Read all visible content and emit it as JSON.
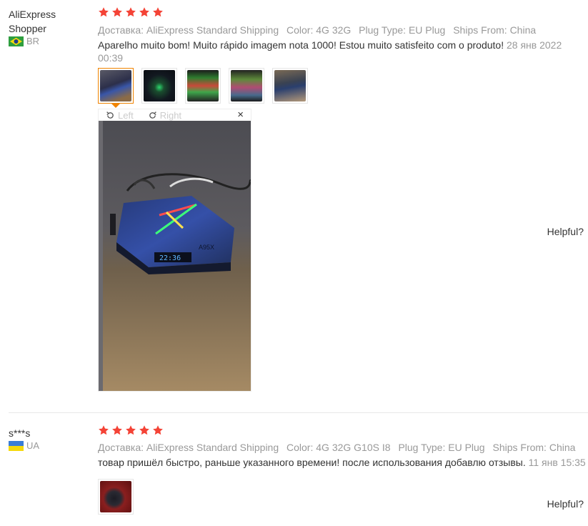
{
  "reviews": [
    {
      "user": {
        "name_line1": "AliExpress",
        "name_line2": "Shopper",
        "country": "BR",
        "flag": "brazil-flag"
      },
      "rating": 5,
      "meta": {
        "shipping": "Доставка: AliExpress Standard Shipping",
        "color": "Color: 4G 32G",
        "plug": "Plug Type: EU Plug",
        "ships_from": "Ships From: China"
      },
      "text": "Aparelho muito bom! Muito rápido imagem nota 1000! Estou muito satisfeito com o produto!",
      "date": "28 янв 2022 00:39",
      "thumbnails": [
        "photo-tv-box-blue",
        "photo-tv-box-dark",
        "photo-screen-green",
        "photo-screen-tv",
        "photo-box-hand"
      ],
      "viewer": {
        "rotate_left": "Left",
        "rotate_right": "Right",
        "close": "×"
      },
      "helpful": "Helpful?"
    },
    {
      "user": {
        "name_line1": "s***s",
        "country": "UA",
        "flag": "ukraine-flag"
      },
      "rating": 5,
      "meta": {
        "shipping": "Доставка: AliExpress Standard Shipping",
        "color": "Color: 4G 32G G10S I8",
        "plug": "Plug Type: EU Plug",
        "ships_from": "Ships From: China"
      },
      "text": "товар пришёл быстро, раньше указанного времени! после использования добавлю отзывы.",
      "date": "11 янв 15:35",
      "thumbnails": [
        "photo-box-red"
      ],
      "helpful": "Helpful?"
    }
  ],
  "colors": {
    "star": "#f44336",
    "active_thumb": "#f08300",
    "muted": "#999999"
  }
}
